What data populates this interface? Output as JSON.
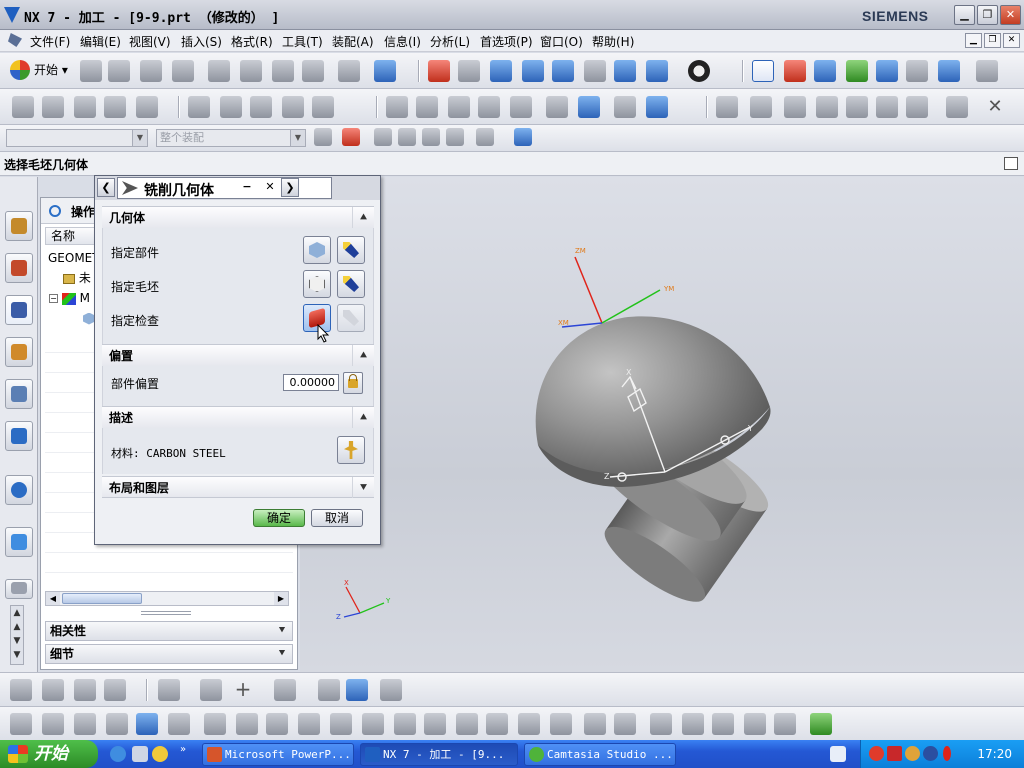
{
  "window": {
    "title": "NX 7 - 加工 - [9-9.prt （修改的） ]",
    "brand": "SIEMENS"
  },
  "menu": {
    "items": [
      "文件(F)",
      "编辑(E)",
      "视图(V)",
      "插入(S)",
      "格式(R)",
      "工具(T)",
      "装配(A)",
      "信息(I)",
      "分析(L)",
      "首选项(P)",
      "窗口(O)",
      "帮助(H)"
    ]
  },
  "toolbar": {
    "start_label": "开始",
    "filter_placeholder": "",
    "assembly_placeholder": "整个装配"
  },
  "cue_line": "选择毛坯几何体",
  "navigator": {
    "title": "操作",
    "column_name": "名称",
    "root_label": "GEOMET",
    "unused_label": "未",
    "mcs_label": "M",
    "related_label": "相关性",
    "details_label": "细节"
  },
  "dialog": {
    "title": "铣削几何体",
    "geometry_group": "几何体",
    "specify_part": "指定部件",
    "specify_blank": "指定毛坯",
    "specify_check": "指定检查",
    "offset_group": "偏置",
    "part_offset_label": "部件偏置",
    "part_offset_value": "0.00000",
    "description_group": "描述",
    "material_text": "材料: CARBON STEEL",
    "layout_group": "布局和图层",
    "ok_label": "确定",
    "cancel_label": "取消"
  },
  "viewport": {
    "axis_x": "X",
    "axis_y": "Y",
    "axis_z": "Z",
    "wcs_x": "XM",
    "wcs_y": "YM",
    "wcs_z": "ZM"
  },
  "taskbar": {
    "start_label": "开始",
    "tasks": [
      "Microsoft PowerP...",
      "NX 7 - 加工 - [9...",
      "Camtasia Studio ..."
    ],
    "clock": "17:20"
  },
  "colors": {
    "accent": "#2d63b8",
    "ok_button": "#59b84a",
    "check_geometry": "#c0180c",
    "model_gray": "#8c8c8c"
  }
}
